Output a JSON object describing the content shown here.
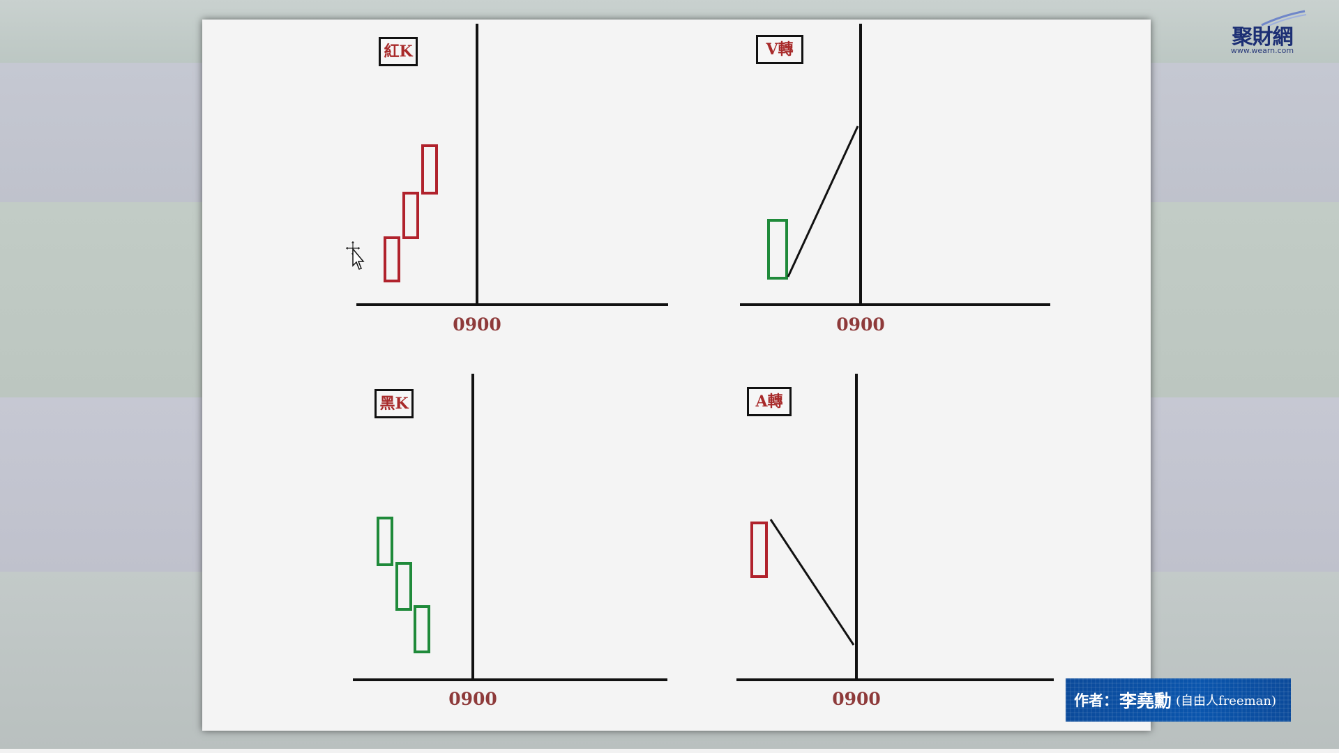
{
  "logo": {
    "name": "聚財網",
    "url": "www.wearn.com"
  },
  "panels": [
    {
      "id": "red-k",
      "label": "紅K",
      "time_label": "0900"
    },
    {
      "id": "v-turn",
      "label": "V轉",
      "time_label": "0900"
    },
    {
      "id": "black-k",
      "label": "黑K",
      "time_label": "0900"
    },
    {
      "id": "a-turn",
      "label": "A轉",
      "time_label": "0900"
    }
  ],
  "author": {
    "prefix": "作者：",
    "name": "李堯勳",
    "alias": "(自由人freeman)"
  },
  "colors": {
    "up_candle": "#b0222c",
    "down_candle": "#1f8a3a",
    "axis": "#111111",
    "label_text": "#a82a2a",
    "time_text": "#8e3a3a",
    "author_bg": "#0b4a9a",
    "logo_text": "#1c2f74"
  },
  "icons": {
    "cursor": "move-cursor-icon"
  }
}
